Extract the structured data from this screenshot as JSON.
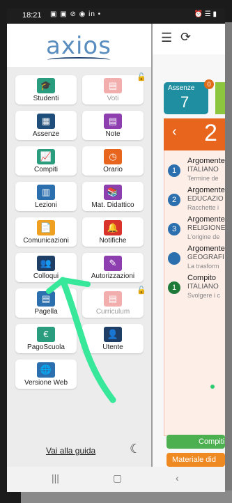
{
  "status_bar": {
    "time": "18:21",
    "left_icons": "▣ ▣ ⊘ ◉ in •",
    "right_icons": "⏰ ☰ ▮"
  },
  "drawer": {
    "logo": "axios",
    "tiles": [
      {
        "label": "Studenti",
        "icon": "graduation-cap-icon",
        "color": "#2a9d7e",
        "glyph": "🎓",
        "locked": false
      },
      {
        "label": "Voti",
        "icon": "grades-icon",
        "color": "#e86b6b",
        "glyph": "▤",
        "locked": true
      },
      {
        "label": "Assenze",
        "icon": "absence-icon",
        "color": "#1f4e7a",
        "glyph": "▦",
        "locked": false
      },
      {
        "label": "Note",
        "icon": "notes-icon",
        "color": "#8e3faf",
        "glyph": "▤",
        "locked": false
      },
      {
        "label": "Compiti",
        "icon": "chart-icon",
        "color": "#2a9d7e",
        "glyph": "📈",
        "locked": false
      },
      {
        "label": "Orario",
        "icon": "clock-icon",
        "color": "#e8651e",
        "glyph": "◷",
        "locked": false
      },
      {
        "label": "Lezioni",
        "icon": "lesson-icon",
        "color": "#2b6fae",
        "glyph": "▥",
        "locked": false
      },
      {
        "label": "Mat. Didattico",
        "icon": "books-icon",
        "color": "#8e3faf",
        "glyph": "📚",
        "locked": false
      },
      {
        "label": "Comunicazioni",
        "icon": "document-icon",
        "color": "#f0a020",
        "glyph": "📄",
        "locked": false
      },
      {
        "label": "Notifiche",
        "icon": "bell-icon",
        "color": "#d8342c",
        "glyph": "🔔",
        "locked": false
      },
      {
        "label": "Colloqui",
        "icon": "people-icon",
        "color": "#1f3e66",
        "glyph": "👥",
        "locked": false
      },
      {
        "label": "Autorizzazioni",
        "icon": "pen-icon",
        "color": "#8e3faf",
        "glyph": "✎",
        "locked": false
      },
      {
        "label": "Pagella",
        "icon": "report-card-icon",
        "color": "#2b6fae",
        "glyph": "▤",
        "locked": false
      },
      {
        "label": "Curriculum",
        "icon": "curriculum-icon",
        "color": "#e86b6b",
        "glyph": "▤",
        "locked": true
      },
      {
        "label": "PagoScuola",
        "icon": "euro-icon",
        "color": "#2a9d7e",
        "glyph": "€",
        "locked": false
      },
      {
        "label": "Utente",
        "icon": "user-icon",
        "color": "#1f3e66",
        "glyph": "👤",
        "locked": false
      },
      {
        "label": "Versione Web",
        "icon": "globe-icon",
        "color": "#2b6fae",
        "glyph": "🌐",
        "locked": false
      }
    ],
    "guide_link": "Vai alla guida"
  },
  "app": {
    "assenze_label": "Assenze",
    "assenze_value": "7",
    "assenze_badge": "0",
    "date_arrow": "‹",
    "date_number": "2",
    "events": [
      {
        "num": "1",
        "color": "#2b6fae",
        "title": "Argomente",
        "subject": "ITALIANO",
        "desc": "Termine de"
      },
      {
        "num": "2",
        "color": "#2b6fae",
        "title": "Argomente",
        "subject": "EDUCAZIO",
        "desc": "Racchette i"
      },
      {
        "num": "3",
        "color": "#2b6fae",
        "title": "Argomente",
        "subject": "RELIGIONE",
        "desc": "L'origine de"
      },
      {
        "num": "",
        "color": "#2b6fae",
        "title": "Argomente",
        "subject": "GEOGRAFI",
        "desc": "La trasform"
      },
      {
        "num": "1",
        "color": "#1f7a3a",
        "title": "Compito",
        "subject": "ITALIANO",
        "desc": "Svolgere i c"
      }
    ],
    "btn_compiti": "Compiti",
    "btn_materiale": "Materiale did"
  },
  "navbar": {
    "recent": "|||",
    "home": "▢",
    "back": "‹"
  }
}
